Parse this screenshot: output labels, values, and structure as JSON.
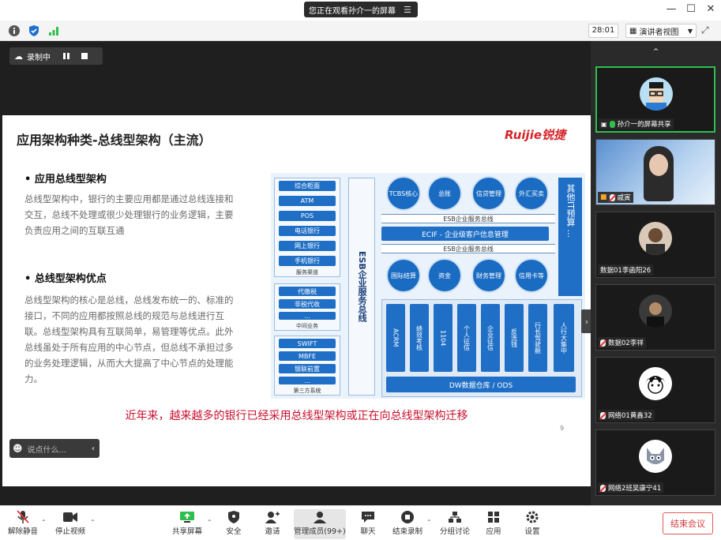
{
  "titlebar": {
    "share_banner": "您正在观看孙介一的屏幕",
    "share_menu_icon": "menu-icon"
  },
  "infobar": {
    "timer": "28:01",
    "view_mode": "演讲者视图"
  },
  "recording": {
    "label": "录制中"
  },
  "slide": {
    "title": "应用架构种类-总线型架构（主流）",
    "logo": "Ruijie锐捷",
    "sections": [
      {
        "heading": "• 应用总线型架构",
        "body": "总线型架构中，银行的主要应用都是通过总线连接和交互，总线不处理或很少处理银行的业务逻辑，主要负责应用之间的互联互通"
      },
      {
        "heading": "• 总线型架构优点",
        "body": "总线型架构的核心是总线，总线发布统一的、标准的接口，不同的应用都按照总线的规范与总线进行互联。总线型架构具有互联简单，易管理等优点。此外总线虽处于所有应用的中心节点，但总线不承担过多的业务处理逻辑，从而大大提高了中心节点的处理能力。"
      }
    ],
    "footer": "近年来，越来越多的银行已经采用总线型架构或正在向总线型架构迁移",
    "page_number": "9",
    "diagram": {
      "channels": [
        "综合柜面",
        "ATM",
        "POS",
        "电话银行",
        "网上银行",
        "手机银行"
      ],
      "channels_label": "服务渠道",
      "middle": [
        "代缴税",
        "非税代收",
        "..."
      ],
      "middle_label": "中间业务",
      "third": [
        "SWIFT",
        "MBFE",
        "银联前置",
        "..."
      ],
      "third_label": "第三方系统",
      "esb_vertical": "ESB企业服务总线",
      "top_circles": [
        "TCBS核心",
        "总账",
        "信贷管理",
        "外汇买卖"
      ],
      "bus1": "ESB企业服务总线",
      "ecif": "ECIF - 企业级客户信息管理",
      "bus2": "ESB企业服务总线",
      "mid_circles": [
        "国际结算",
        "资金",
        "财务管理",
        "信用卡等"
      ],
      "right_vertical": "其他IT预算 ...",
      "bottom_cols": [
        "ACRM",
        "绩效考核",
        "1104",
        "个人征信",
        "企业征信",
        "反洗钱",
        "行长驾驶舱",
        "人行大集中"
      ],
      "dw": "DW数据仓库 / ODS"
    }
  },
  "chat": {
    "placeholder": "说点什么..."
  },
  "participants": [
    {
      "name": "孙介一的屏幕共享",
      "avatar": "cartoon-avatar-icon"
    },
    {
      "name": "戚寅",
      "avatar": "video-feed"
    },
    {
      "name": "数据01李函阳26",
      "avatar": "photo-avatar-icon"
    },
    {
      "name": "数据02李祥",
      "avatar": "photo-avatar-icon"
    },
    {
      "name": "网络01黄鑫32",
      "avatar": "sketch-avatar-icon"
    },
    {
      "name": "网络2班吴康宁41",
      "avatar": "cartoon-cat-icon"
    }
  ],
  "toolbar": {
    "unmute": "解除静音",
    "stop_video": "停止视频",
    "share_screen": "共享屏幕",
    "security": "安全",
    "invite": "邀请",
    "manage_members": "管理成员(99+)",
    "chat": "聊天",
    "end_recording": "结束录制",
    "breakout": "分组讨论",
    "apps": "应用",
    "settings": "设置",
    "end_meeting": "结束会议"
  }
}
